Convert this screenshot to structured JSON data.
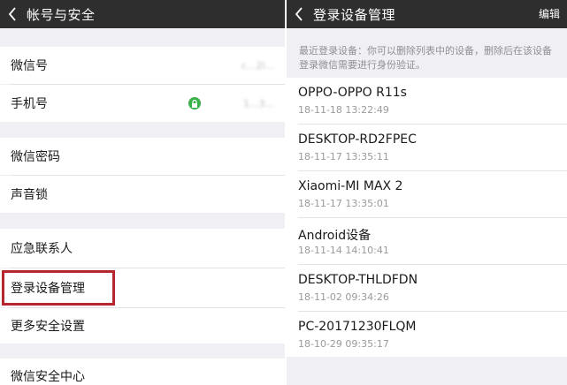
{
  "left": {
    "title": "帐号与安全",
    "rows": [
      {
        "label": "微信号",
        "value": "c...2l..."
      },
      {
        "label": "手机号",
        "value": "1...3..."
      },
      {
        "label": "微信密码"
      },
      {
        "label": "声音锁"
      },
      {
        "label": "应急联系人"
      },
      {
        "label": "登录设备管理"
      },
      {
        "label": "更多安全设置"
      },
      {
        "label": "微信安全中心"
      }
    ],
    "colors": {
      "titlebar": "#2e2e2e",
      "highlight": "#b5262e",
      "lock_badge": "#3bb14a"
    }
  },
  "right": {
    "title": "登录设备管理",
    "edit_label": "编辑",
    "hint": "最近登录设备：你可以删除列表中的设备，删除后在该设备登录微信需要进行身份验证。",
    "devices": [
      {
        "name": "OPPO-OPPO R11s",
        "time": "18-11-18 13:22:49"
      },
      {
        "name": "DESKTOP-RD2FPEC",
        "time": "18-11-17 13:35:11"
      },
      {
        "name": "Xiaomi-MI MAX 2",
        "time": "18-11-17 13:35:01"
      },
      {
        "name": "Android设备",
        "time": "18-11-14 14:10:41"
      },
      {
        "name": "DESKTOP-THLDFDN",
        "time": "18-11-02 09:34:26"
      },
      {
        "name": "PC-20171230FLQM",
        "time": "18-10-29 09:35:17"
      }
    ]
  },
  "icons": {
    "back": "chevron-left-icon",
    "lock": "lock-icon"
  }
}
